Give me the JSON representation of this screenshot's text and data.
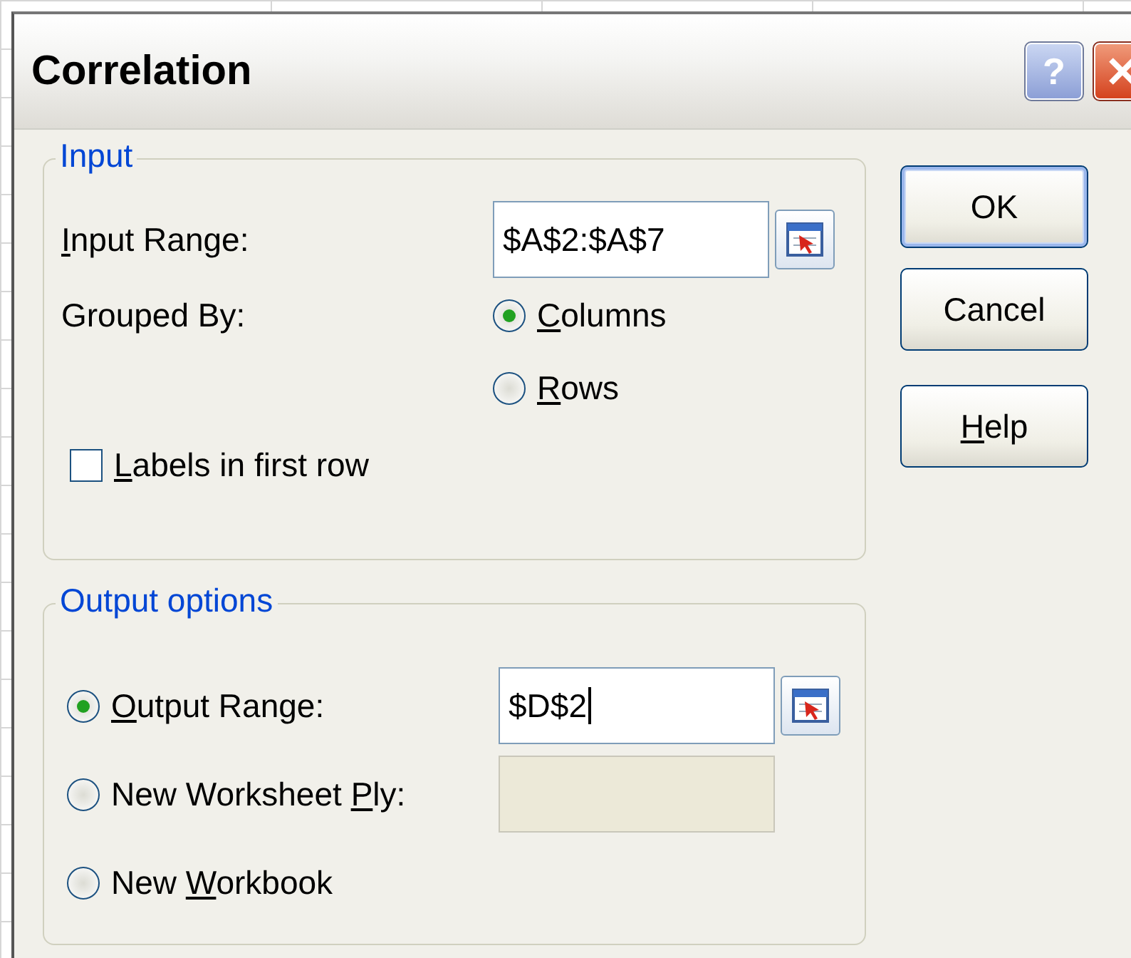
{
  "window": {
    "title": "Correlation",
    "help_glyph": "?"
  },
  "input_group": {
    "title": "Input",
    "input_range": {
      "label": {
        "key": "I",
        "post": "nput Range:"
      },
      "value": "$A$2:$A$7"
    },
    "grouped_by": {
      "label": "Grouped By:",
      "options": [
        {
          "label": {
            "key": "C",
            "post": "olumns"
          },
          "selected": true
        },
        {
          "label": {
            "key": "R",
            "post": "ows"
          },
          "selected": false
        }
      ]
    },
    "labels_in_first_row": {
      "label": {
        "key": "L",
        "post": "abels in first row"
      },
      "checked": false
    }
  },
  "output_group": {
    "title": "Output options",
    "options": [
      {
        "label": {
          "key": "O",
          "post": "utput Range:"
        },
        "selected": true,
        "field": {
          "value": "$D$2",
          "disabled": false,
          "focused": true
        }
      },
      {
        "label": {
          "pre": "New Worksheet ",
          "key": "P",
          "post": "ly:"
        },
        "selected": false,
        "field": {
          "disabled": true,
          "focused": false
        }
      },
      {
        "label": {
          "pre": "New ",
          "key": "W",
          "post": "orkbook"
        },
        "selected": false
      }
    ]
  },
  "buttons": [
    {
      "label": {
        "post": "OK"
      },
      "default": true
    },
    {
      "label": {
        "post": "Cancel"
      },
      "default": false
    },
    {
      "label": {
        "key": "H",
        "post": "elp"
      },
      "default": false
    }
  ]
}
